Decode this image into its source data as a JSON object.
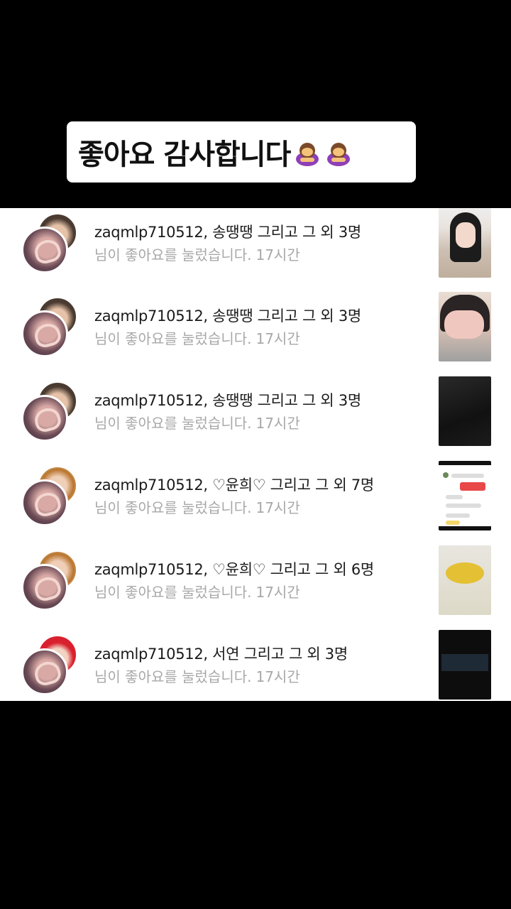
{
  "banner": {
    "text": "좋아요 감사합니다"
  },
  "notifications": [
    {
      "users": "zaqmlp710512, 송땡땡 그리고 그 외 3명",
      "message": "님이 좋아요를 눌렀습니다.",
      "time": "17시간"
    },
    {
      "users": "zaqmlp710512, 송땡땡 그리고 그 외 3명",
      "message": "님이 좋아요를 눌렀습니다.",
      "time": "17시간"
    },
    {
      "users": "zaqmlp710512, 송땡땡 그리고 그 외 3명",
      "message": "님이 좋아요를 눌렀습니다.",
      "time": "17시간"
    },
    {
      "users": "zaqmlp710512, ♡윤희♡ 그리고 그 외 7명",
      "message": "님이 좋아요를 눌렀습니다.",
      "time": "17시간"
    },
    {
      "users": "zaqmlp710512, ♡윤희♡ 그리고 그 외 6명",
      "message": "님이 좋아요를 눌렀습니다.",
      "time": "17시간"
    },
    {
      "users": "zaqmlp710512, 서연 그리고 그 외 3명",
      "message": "님이 좋아요를 눌렀습니다.",
      "time": "17시간"
    }
  ],
  "colors": {
    "background": "#000000",
    "panel": "#ffffff",
    "secondary_text": "#a8a8a8"
  }
}
